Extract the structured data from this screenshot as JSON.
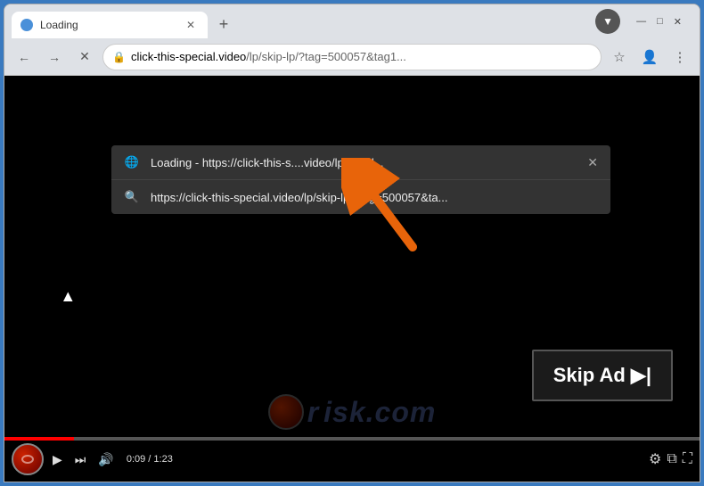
{
  "browser": {
    "tab": {
      "title": "Loading",
      "favicon_color": "#4a90d9"
    },
    "window_controls": {
      "minimize": "—",
      "maximize": "□",
      "close": "✕"
    },
    "new_tab_label": "+",
    "toolbar": {
      "back_label": "←",
      "forward_label": "→",
      "stop_label": "✕",
      "url_domain": "click-this-special.video",
      "url_path": "/lp/skip-lp/?tag=500057&tag1...",
      "url_full": "click-this-special.video/lp/skip-lp/?tag=500057&tag1...",
      "star_label": "☆",
      "profile_label": "👤",
      "menu_label": "⋮"
    },
    "dropdown": {
      "items": [
        {
          "icon": "🌐",
          "text": "Loading  -  https://click-this-s....video/lp/skip-l...",
          "has_close": true
        },
        {
          "icon": "🔍",
          "text": "https://click-this-special.video/lp/skip-lp/?tag=500057&ta...",
          "has_close": false
        }
      ]
    }
  },
  "video": {
    "skip_ad_label": "Skip Ad ▶|",
    "time_current": "0:09",
    "time_total": "1:23",
    "time_display": "0:09 / 1:23",
    "watermark": "risk.com"
  },
  "arrow": {
    "color": "#e8640a"
  }
}
